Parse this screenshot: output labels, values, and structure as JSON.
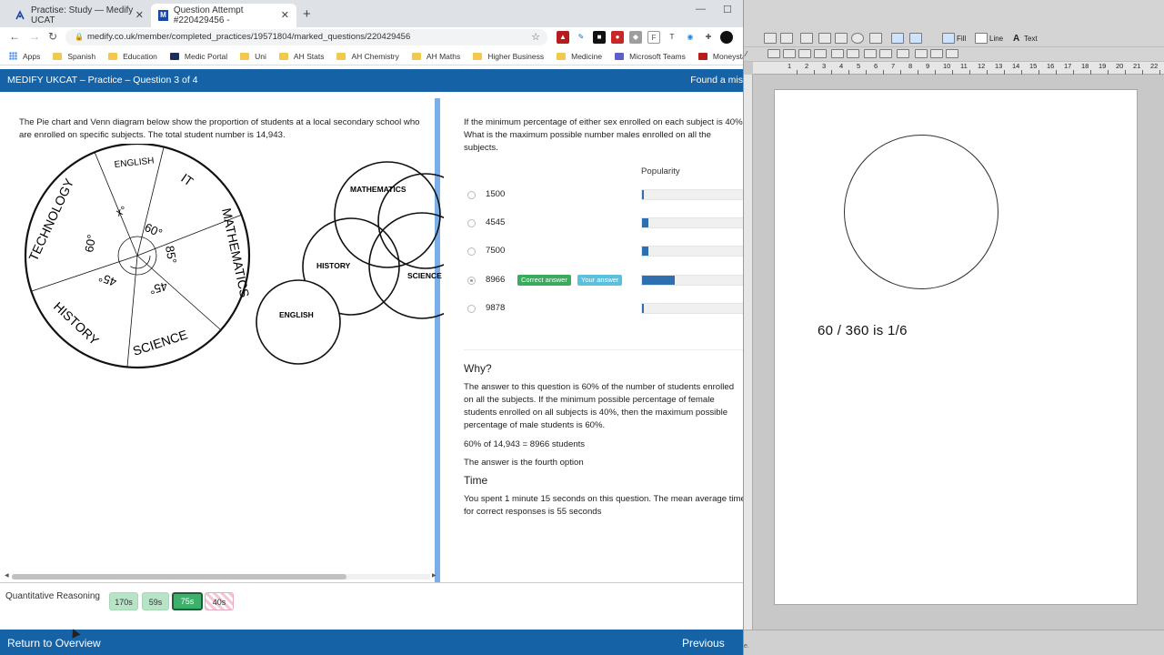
{
  "browser": {
    "tabs": [
      {
        "title": "Practise: Study — Medify UCAT"
      },
      {
        "title": "Question Attempt #220429456 -"
      }
    ],
    "url": "medify.co.uk/member/completed_practices/19571804/marked_questions/220429456",
    "bookmarks": [
      "Apps",
      "Spanish",
      "Education",
      "Medic Portal",
      "Uni",
      "AH Stats",
      "AH Chemistry",
      "AH Maths",
      "Higher Business",
      "Medicine",
      "Microsoft Teams",
      "Moneystats"
    ]
  },
  "header": {
    "title": "MEDIFY UKCAT – Practice – Question 3 of 4",
    "right_text": "Found a mis"
  },
  "left": {
    "intro": "The Pie chart and Venn diagram below show the proportion of students at a local secondary school who are enrolled on specific subjects. The total student number is 14,943.",
    "pie": {
      "segments": [
        "ENGLISH",
        "IT",
        "MATHEMATICS",
        "SCIENCE",
        "HISTORY",
        "TECHNOLOGY"
      ],
      "angles": [
        "x°",
        "60°",
        "85°",
        "45°",
        "45°",
        "60°"
      ]
    },
    "venn": [
      "MATHEMATICS",
      "HISTORY",
      "SCIENCE",
      "ENGLISH"
    ]
  },
  "right": {
    "question": "If the minimum percentage of either sex enrolled on each subject is 40%. What is the maximum possible number males enrolled on all the subjects.",
    "popularity_label": "Popularity",
    "options": [
      {
        "value": "1500",
        "selected": false,
        "popularity": 0.01
      },
      {
        "value": "4545",
        "selected": false,
        "popularity": 0.05
      },
      {
        "value": "7500",
        "selected": false,
        "popularity": 0.05
      },
      {
        "value": "8966",
        "selected": true,
        "popularity": 0.26,
        "correct_badge": "Correct answer",
        "your_badge": "Your answer"
      },
      {
        "value": "9878",
        "selected": false,
        "popularity": 0.01
      }
    ],
    "why_title": "Why?",
    "why_text": "The answer to this question is 60% of the number of students enrolled on all the subjects. If the minimum possible percentage of female students enrolled on all subjects is 40%, then the maximum possible percentage of male students is 60%.",
    "calc": "60% of 14,943 = 8966 students",
    "answer_line": "The answer is the fourth option",
    "time_title": "Time",
    "time_text": "You spent 1 minute 15 seconds on this question. The mean average time for correct responses is 55 seconds"
  },
  "timing": {
    "label": "Quantitative Reasoning",
    "buttons": [
      "170s",
      "59s",
      "75s",
      "40s"
    ]
  },
  "footer": {
    "return": "Return to Overview",
    "previous": "Previous"
  },
  "drawing": {
    "toolbar_labels": {
      "fill": "Fill",
      "line": "Line",
      "text": "Text"
    },
    "ruler_numbers": [
      "1",
      "2",
      "3",
      "4",
      "5",
      "6",
      "7",
      "8",
      "9",
      "10",
      "11",
      "12",
      "13",
      "14",
      "15",
      "16",
      "17",
      "18",
      "19",
      "20",
      "21",
      "22"
    ],
    "note": "60 / 360 is 1/6"
  }
}
